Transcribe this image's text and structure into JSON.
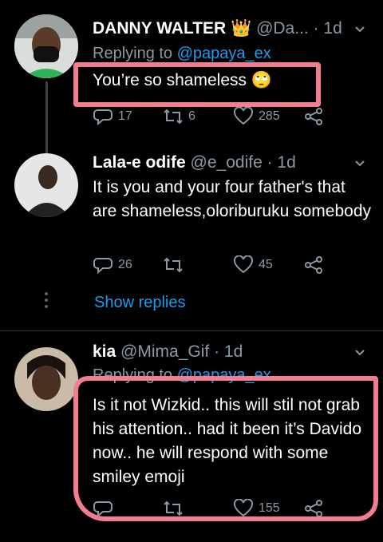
{
  "tweets": [
    {
      "name": "DANNY WALTER",
      "badge": "👑",
      "handle": "@Da...",
      "time": "· 1d",
      "replying_prefix": "Replying to",
      "replying_handle": "@papaya_ex",
      "text": "You’re so shameless 🙄",
      "replies": "17",
      "retweets": "6",
      "likes": "285"
    },
    {
      "name": "Lala-e odife",
      "handle": "@e_odife",
      "time": "· 1d",
      "text": "It is you and your four father's that are shameless,oloriburuku somebody",
      "replies": "26",
      "retweets": "",
      "likes": "45",
      "show_replies": "Show replies"
    },
    {
      "name": "kia",
      "handle": "@Mima_Gif",
      "time": "· 1d",
      "replying_prefix": "Replying to",
      "replying_handle": "@papaya_ex",
      "text": "Is it not Wizkid.. this will stil not grab his attention.. had it been it’s Davido now.. he will respond with some smiley emoji",
      "replies": "",
      "retweets": "",
      "likes": "155"
    }
  ],
  "icons": {
    "reply": "reply-icon",
    "retweet": "retweet-icon",
    "like": "heart-icon",
    "share": "share-icon",
    "more": "chevron-down-icon"
  },
  "colors": {
    "background": "#000000",
    "link": "#1d9bf0",
    "muted": "#8b98a5",
    "highlight": "#f07e8e"
  }
}
